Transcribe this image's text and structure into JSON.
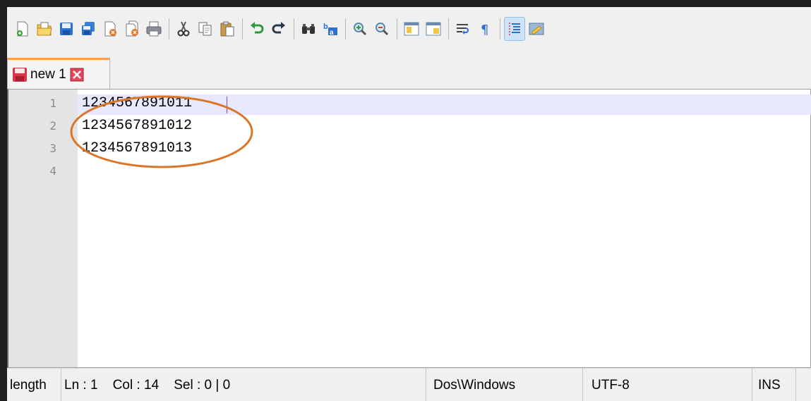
{
  "toolbar": {
    "buttons": [
      {
        "name": "new-file-icon"
      },
      {
        "name": "open-file-icon"
      },
      {
        "name": "save-icon"
      },
      {
        "name": "save-all-icon"
      },
      {
        "name": "close-icon"
      },
      {
        "name": "close-all-icon"
      },
      {
        "name": "print-icon"
      },
      {
        "name": "cut-icon"
      },
      {
        "name": "copy-icon"
      },
      {
        "name": "paste-icon"
      },
      {
        "name": "undo-icon"
      },
      {
        "name": "redo-icon"
      },
      {
        "name": "find-icon"
      },
      {
        "name": "replace-icon"
      },
      {
        "name": "zoom-in-icon"
      },
      {
        "name": "zoom-out-icon"
      },
      {
        "name": "sync-vertical-icon"
      },
      {
        "name": "sync-horizontal-icon"
      },
      {
        "name": "word-wrap-icon"
      },
      {
        "name": "show-all-characters-icon"
      },
      {
        "name": "indent-guide-icon"
      },
      {
        "name": "user-defined-language-icon"
      }
    ]
  },
  "tabs": [
    {
      "label": "new 1"
    }
  ],
  "editor": {
    "line_numbers": [
      "1",
      "2",
      "3",
      "4"
    ],
    "lines": [
      "1234567891011",
      "1234567891012",
      "1234567891013",
      ""
    ]
  },
  "statusbar": {
    "length": "length",
    "position": "Ln : 1    Col : 14    Sel : 0 | 0",
    "eol": "Dos\\Windows",
    "encoding": "UTF-8",
    "mode": "INS"
  },
  "colors": {
    "tab_accent": "#f9a04a",
    "current_line": "#e8e8ff",
    "annotation": "#d9762a",
    "caret": "#7a40ff"
  }
}
